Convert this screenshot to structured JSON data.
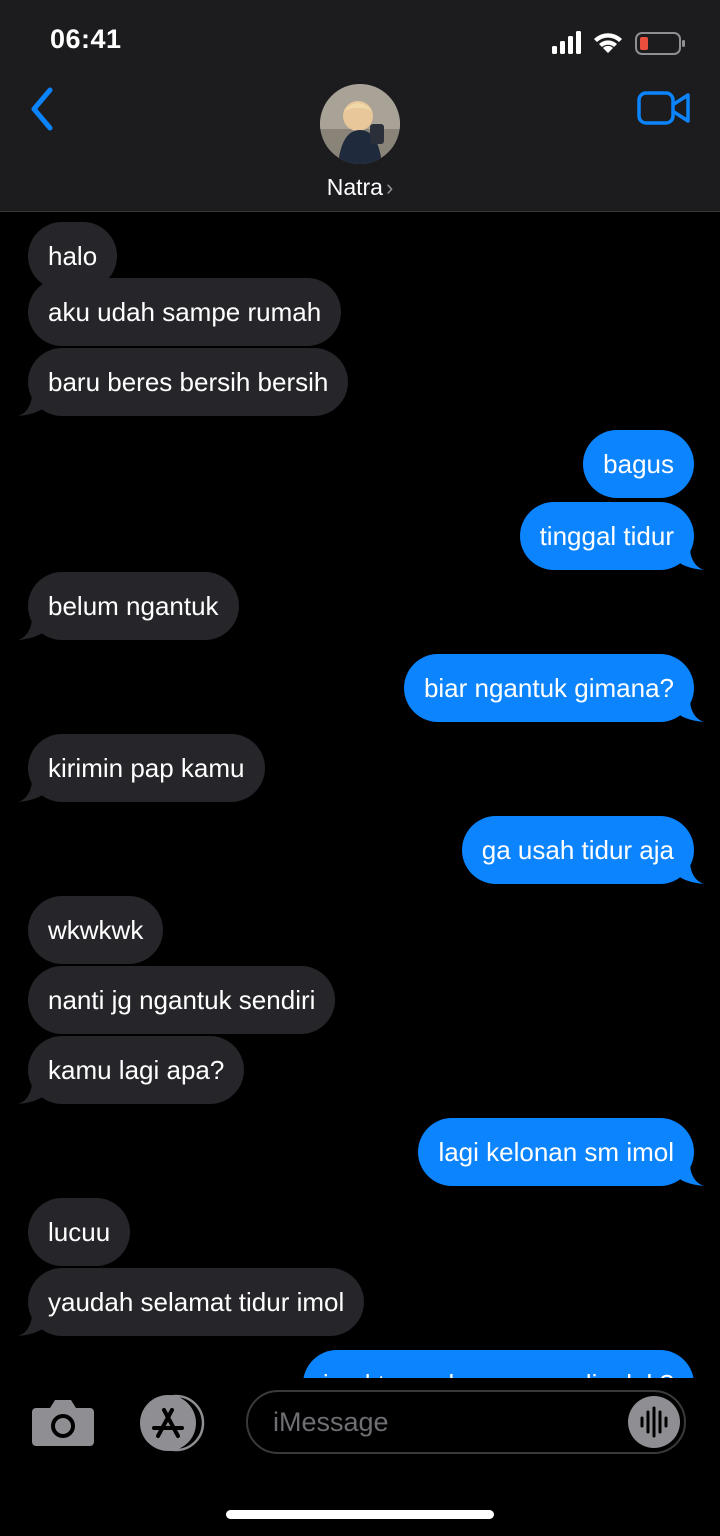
{
  "status_bar": {
    "time": "06:41"
  },
  "header": {
    "contact_name": "Natra",
    "chevron": "›"
  },
  "messages": [
    {
      "text": "halo",
      "direction": "in"
    },
    {
      "text": "aku udah sampe rumah",
      "direction": "in"
    },
    {
      "text": "baru beres bersih bersih",
      "direction": "in"
    },
    {
      "text": "bagus",
      "direction": "out"
    },
    {
      "text": "tinggal tidur",
      "direction": "out"
    },
    {
      "text": "belum ngantuk",
      "direction": "in"
    },
    {
      "text": "biar ngantuk gimana?",
      "direction": "out"
    },
    {
      "text": "kirimin pap kamu",
      "direction": "in"
    },
    {
      "text": "ga usah tidur aja",
      "direction": "out"
    },
    {
      "text": "wkwkwk",
      "direction": "in"
    },
    {
      "text": "nanti jg ngantuk sendiri",
      "direction": "in"
    },
    {
      "text": "kamu lagi apa?",
      "direction": "in"
    },
    {
      "text": "lagi kelonan sm imol",
      "direction": "out"
    },
    {
      "text": "lucuu",
      "direction": "in"
    },
    {
      "text": "yaudah selamat tidur imol",
      "direction": "in"
    },
    {
      "text": "imol tanya kamu mau dipeluk?",
      "direction": "out"
    }
  ],
  "composer": {
    "placeholder": "iMessage"
  },
  "colors": {
    "accent": "#0b84fe",
    "incoming_bubble": "#26252a",
    "header_bg": "#1c1c1e",
    "battery_low": "#eb4e3d"
  },
  "icons": [
    "back-chevron-icon",
    "video-camera-icon",
    "camera-icon",
    "app-store-icon",
    "audio-waveform-icon",
    "signal-icon",
    "wifi-icon",
    "battery-icon"
  ]
}
